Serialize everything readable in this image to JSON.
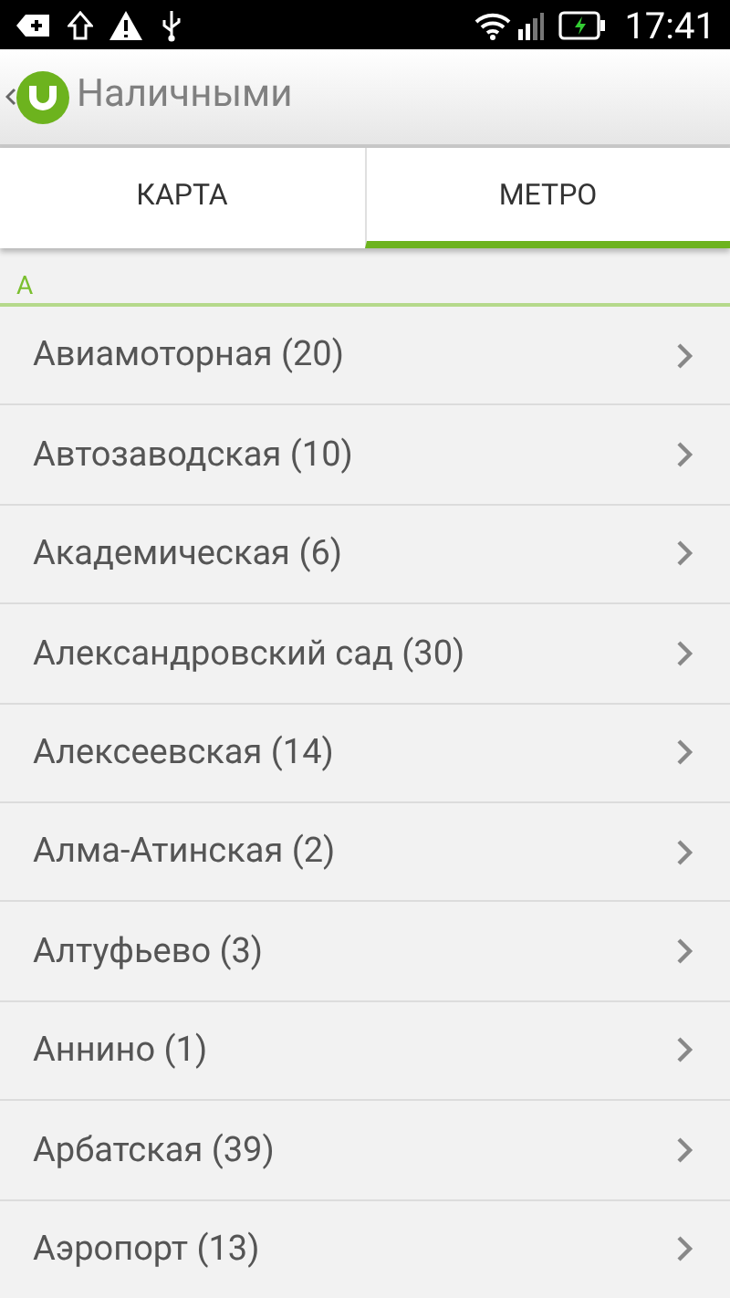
{
  "status_bar": {
    "time": "17:41"
  },
  "app_bar": {
    "title": "Наличными"
  },
  "tabs": [
    {
      "label": "КАРТА",
      "selected": false
    },
    {
      "label": "МЕТРО",
      "selected": true
    }
  ],
  "section": {
    "header": "А"
  },
  "stations": [
    {
      "label": "Авиамоторная (20)"
    },
    {
      "label": "Автозаводская (10)"
    },
    {
      "label": "Академическая (6)"
    },
    {
      "label": "Александровский сад (30)"
    },
    {
      "label": "Алексеевская (14)"
    },
    {
      "label": "Алма-Атинская (2)"
    },
    {
      "label": "Алтуфьево (3)"
    },
    {
      "label": "Аннино (1)"
    },
    {
      "label": "Арбатская (39)"
    },
    {
      "label": "Аэропорт (13)"
    }
  ]
}
